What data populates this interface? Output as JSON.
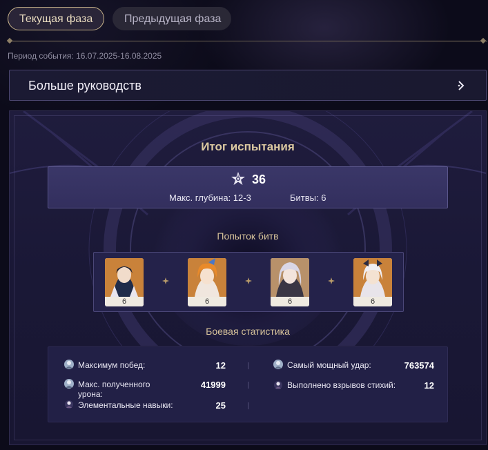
{
  "tabs": {
    "current": "Текущая фаза",
    "previous": "Предыдущая фаза"
  },
  "event_period": "Период события: 16.07.2025-16.08.2025",
  "guide_button": {
    "label": "Больше руководств",
    "icon": "chevron-right-icon"
  },
  "summary": {
    "title": "Итог испытания",
    "stars": "36",
    "star_icon": "abyss-star-icon",
    "max_depth": "Макс. глубина: 12-3",
    "battles": "Битвы: 6"
  },
  "attempts": {
    "title": "Попыток битв",
    "characters": [
      {
        "name": "character-1",
        "count": "6",
        "bg": "#c9823a"
      },
      {
        "name": "character-2",
        "count": "6",
        "bg": "#c9823a"
      },
      {
        "name": "character-3",
        "count": "6",
        "bg": "#b8916a"
      },
      {
        "name": "character-4",
        "count": "6",
        "bg": "#c9823a"
      }
    ]
  },
  "battle_stats": {
    "title": "Боевая статистика",
    "items": [
      {
        "label": "Максимум побед:",
        "value": "12"
      },
      {
        "label": "Самый мощный удар:",
        "value": "763574"
      },
      {
        "label": "Макс. полученного урона:",
        "value": "41999"
      },
      {
        "label": "Выполнено взрывов стихий:",
        "value": "12"
      },
      {
        "label": "Элементальные навыки:",
        "value": "25"
      }
    ]
  },
  "colors": {
    "accent_gold": "#dcc9a1",
    "background": "#0c0b1a",
    "card": "#1f1c3d"
  }
}
